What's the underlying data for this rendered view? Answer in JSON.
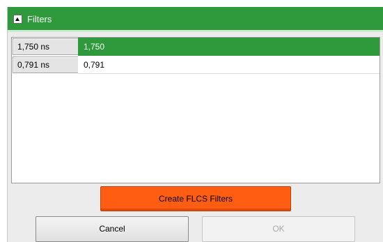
{
  "panel": {
    "title": "Filters",
    "collapse_icon": "collapse-up-icon"
  },
  "filters": [
    {
      "key": "1,750 ns",
      "value": "1,750",
      "selected": true
    },
    {
      "key": "0,791 ns",
      "value": "0,791",
      "selected": false
    }
  ],
  "buttons": {
    "create": "Create FLCS Filters",
    "cancel": "Cancel",
    "ok": "OK"
  },
  "colors": {
    "header": "#2e9a3c",
    "selected_row": "#2e9a3c",
    "create_button": "#ff5d12"
  }
}
